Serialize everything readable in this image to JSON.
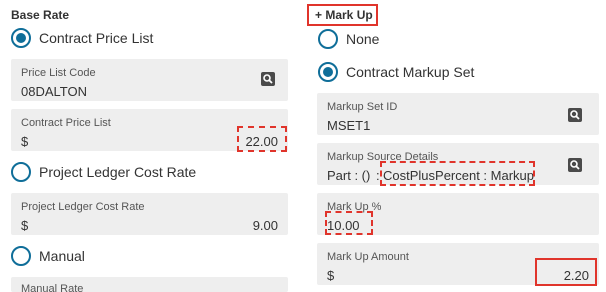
{
  "base_rate": {
    "title": "Base Rate",
    "options": {
      "contract_price_list": "Contract Price List",
      "project_ledger_cost_rate": "Project Ledger Cost Rate",
      "manual": "Manual"
    },
    "price_list_code": {
      "label": "Price List Code",
      "value": "08DALTON"
    },
    "contract_price_list": {
      "label": "Contract Price List",
      "currency": "$",
      "amount": "22.00"
    },
    "project_ledger_cost_rate": {
      "label": "Project Ledger Cost Rate",
      "currency": "$",
      "amount": "9.00"
    },
    "manual_rate": {
      "label": "Manual Rate"
    }
  },
  "mark_up": {
    "title": "+ Mark Up",
    "options": {
      "none": "None",
      "contract_markup_set": "Contract Markup Set"
    },
    "markup_set_id": {
      "label": "Markup Set ID",
      "value": "MSET1"
    },
    "markup_source_details": {
      "label": "Markup Source Details",
      "prefix": "Part : ()",
      "separator": ":",
      "highlighted": "CostPlusPercent : Markup"
    },
    "mark_up_percent": {
      "label": "Mark Up %",
      "value": "10.00"
    },
    "mark_up_amount": {
      "label": "Mark Up Amount",
      "currency": "$",
      "amount": "2.20"
    }
  },
  "colors": {
    "accent": "#0f6e99",
    "highlight": "#e0342b",
    "field_bg": "#eeeeee"
  }
}
